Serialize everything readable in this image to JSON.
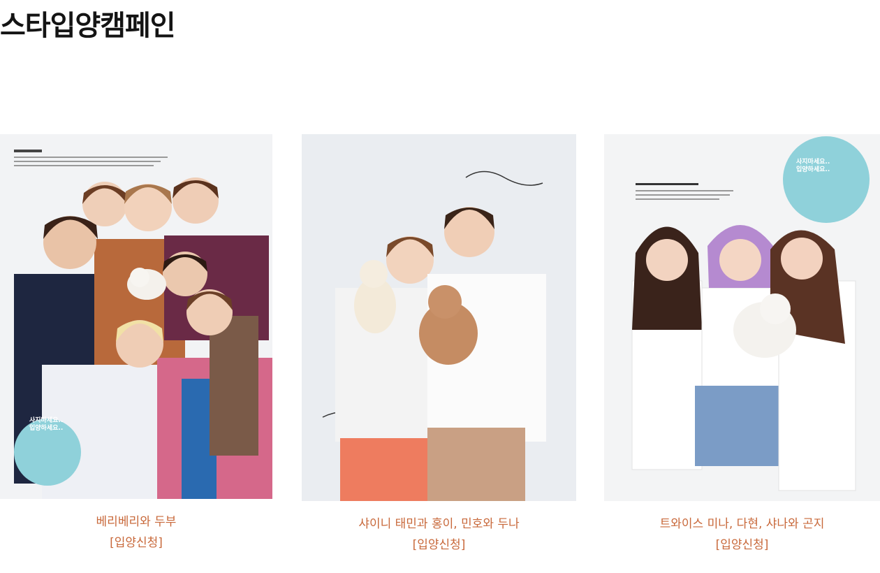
{
  "page": {
    "title": "스타입양캠페인"
  },
  "cards": [
    {
      "name": "베리베리와 두부",
      "apply": "[입양신청]",
      "photo_alt": "베리베리와 두부 화보",
      "badge": "사지마세요..\n입양하세요.."
    },
    {
      "name": "샤이니 태민과 홍이, 민호와 두나",
      "apply": "[입양신청]",
      "photo_alt": "샤이니 태민과 홍이, 민호와 두나 화보"
    },
    {
      "name": "트와이스 미나, 다현, 샤나와 곤지",
      "apply": "[입양신청]",
      "photo_alt": "트와이스 미나, 다현, 샤나와 곤지 화보",
      "badge": "사지마세요..\n입양하세요.."
    }
  ],
  "colors": {
    "caption": "#c8683a",
    "title": "#141414",
    "badge": "#8fd1da"
  }
}
